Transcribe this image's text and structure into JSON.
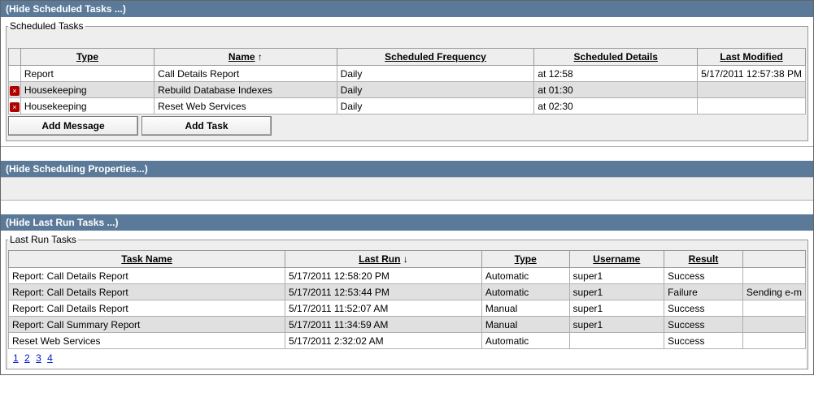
{
  "sections": {
    "hide_scheduled": "(Hide Scheduled Tasks ...)",
    "hide_props": "(Hide Scheduling Properties...)",
    "hide_last": "(Hide Last Run Tasks ...)"
  },
  "scheduled": {
    "legend": "Scheduled Tasks",
    "headers": {
      "type": "Type",
      "name": "Name",
      "freq": "Scheduled Frequency",
      "details": "Scheduled Details",
      "modified": "Last Modified"
    },
    "sort_indicator": "↑",
    "rows": [
      {
        "icon": "",
        "type": "Report",
        "name": "Call Details Report",
        "freq": "Daily",
        "details": "at 12:58",
        "modified": "5/17/2011 12:57:38 PM"
      },
      {
        "icon": "x",
        "type": "Housekeeping",
        "name": "Rebuild Database Indexes",
        "freq": "Daily",
        "details": "at 01:30",
        "modified": ""
      },
      {
        "icon": "x",
        "type": "Housekeeping",
        "name": "Reset Web Services",
        "freq": "Daily",
        "details": "at 02:30",
        "modified": ""
      }
    ],
    "buttons": {
      "add_msg": "Add Message",
      "add_task": "Add Task"
    }
  },
  "lastrun": {
    "legend": "Last Run Tasks",
    "headers": {
      "name": "Task Name",
      "last": "Last Run",
      "type": "Type",
      "user": "Username",
      "result": "Result",
      "extra": ""
    },
    "sort_indicator": "↓",
    "rows": [
      {
        "name": "Report: Call Details Report",
        "last": "5/17/2011 12:58:20 PM",
        "type": "Automatic",
        "user": "super1",
        "result": "Success",
        "extra": ""
      },
      {
        "name": "Report: Call Details Report",
        "last": "5/17/2011 12:53:44 PM",
        "type": "Automatic",
        "user": "super1",
        "result": "Failure",
        "extra": "Sending e-m"
      },
      {
        "name": "Report: Call Details Report",
        "last": "5/17/2011 11:52:07 AM",
        "type": "Manual",
        "user": "super1",
        "result": "Success",
        "extra": ""
      },
      {
        "name": "Report: Call Summary Report",
        "last": "5/17/2011 11:34:59 AM",
        "type": "Manual",
        "user": "super1",
        "result": "Success",
        "extra": ""
      },
      {
        "name": "Reset Web Services",
        "last": "5/17/2011 2:32:02 AM",
        "type": "Automatic",
        "user": "",
        "result": "Success",
        "extra": ""
      }
    ],
    "pager": [
      "1",
      "2",
      "3",
      "4"
    ]
  }
}
